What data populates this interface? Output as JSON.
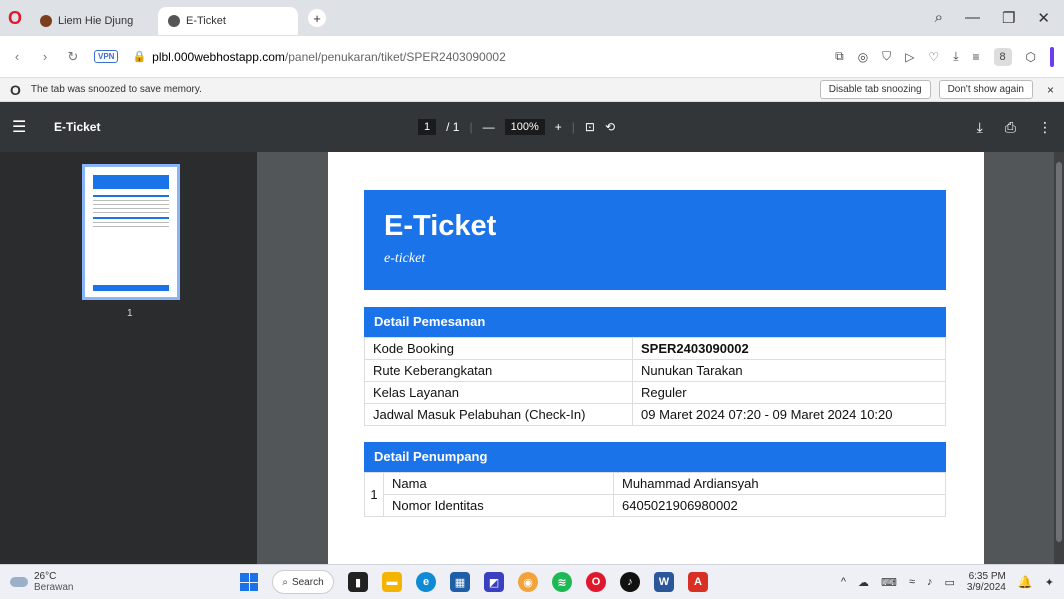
{
  "browser": {
    "tabs": [
      {
        "label": "Liem Hie Djung",
        "active": false
      },
      {
        "label": "E-Ticket",
        "active": true
      }
    ],
    "url_host": "plbl.000webhostapp.com",
    "url_path": "/panel/penukaran/tiket/SPER2403090002",
    "vpn_label": "VPN",
    "infobar": {
      "message": "The tab was snoozed to save memory.",
      "disable_btn": "Disable tab snoozing",
      "dont_show_btn": "Don't show again"
    }
  },
  "pdf": {
    "title": "E-Ticket",
    "page_current": "1",
    "page_total": "/ 1",
    "zoom": "100%",
    "thumb_label": "1"
  },
  "ticket": {
    "heading": "E-Ticket",
    "subheading": "e-ticket",
    "booking_section": "Detail Pemesanan",
    "booking_rows": [
      {
        "label": "Kode Booking",
        "value": "SPER2403090002"
      },
      {
        "label": "Rute Keberangkatan",
        "value": "Nunukan  Tarakan"
      },
      {
        "label": "Kelas Layanan",
        "value": "Reguler"
      },
      {
        "label": "Jadwal Masuk Pelabuhan (Check-In)",
        "value": "09 Maret 2024 07:20 - 09 Maret 2024 10:20"
      }
    ],
    "passenger_section": "Detail Penumpang",
    "passenger": {
      "number": "1",
      "name_label": "Nama",
      "name_value": "Muhammad Ardiansyah",
      "id_label": "Nomor Identitas",
      "id_value": "6405021906980002"
    }
  },
  "taskbar": {
    "temperature": "26°C",
    "condition": "Berawan",
    "search_label": "Search",
    "time": "6:35 PM",
    "date": "3/9/2024"
  },
  "colors": {
    "accent_blue": "#1a73e8",
    "pdf_toolbar": "#323639"
  }
}
